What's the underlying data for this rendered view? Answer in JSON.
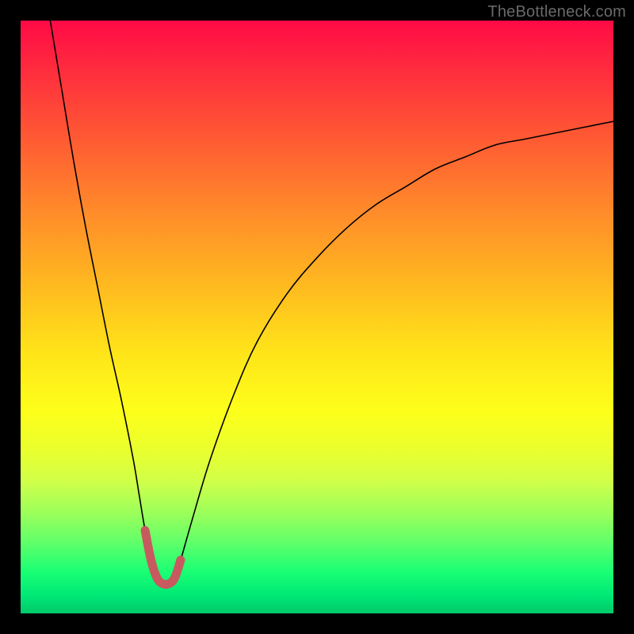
{
  "watermark": {
    "text": "TheBottleneck.com"
  },
  "chart_data": {
    "type": "line",
    "title": "",
    "xlabel": "",
    "ylabel": "",
    "xlim": [
      0,
      100
    ],
    "ylim": [
      0,
      100
    ],
    "grid": false,
    "legend": false,
    "background_gradient": {
      "direction": "vertical",
      "stops": [
        {
          "pos": 0,
          "color": "#ff0a46"
        },
        {
          "pos": 25,
          "color": "#ff7a2e"
        },
        {
          "pos": 50,
          "color": "#ffd21c"
        },
        {
          "pos": 70,
          "color": "#f5ff20"
        },
        {
          "pos": 85,
          "color": "#8dff55"
        },
        {
          "pos": 100,
          "color": "#00c96a"
        }
      ]
    },
    "series": [
      {
        "name": "bottleneck-curve",
        "style": {
          "stroke": "#000000",
          "strokeWidth": 1.6
        },
        "x": [
          5,
          7,
          9,
          11,
          13,
          15,
          17,
          19,
          20,
          21,
          22,
          23,
          24,
          25,
          26,
          27,
          29,
          32,
          36,
          40,
          45,
          50,
          55,
          60,
          65,
          70,
          75,
          80,
          85,
          90,
          95,
          100
        ],
        "values": [
          100,
          88,
          76,
          65,
          55,
          45,
          36,
          26,
          20,
          14,
          9,
          6,
          5,
          5,
          6,
          9,
          16,
          26,
          37,
          46,
          54,
          60,
          65,
          69,
          72,
          75,
          77,
          79,
          80,
          81,
          82,
          83
        ]
      },
      {
        "name": "highlight-valley",
        "style": {
          "stroke": "#c65a5f",
          "strokeWidth": 11,
          "linecap": "round"
        },
        "x": [
          21,
          22,
          23,
          24,
          25,
          26,
          27
        ],
        "values": [
          14,
          9,
          6,
          5,
          5,
          6,
          9
        ]
      }
    ]
  }
}
